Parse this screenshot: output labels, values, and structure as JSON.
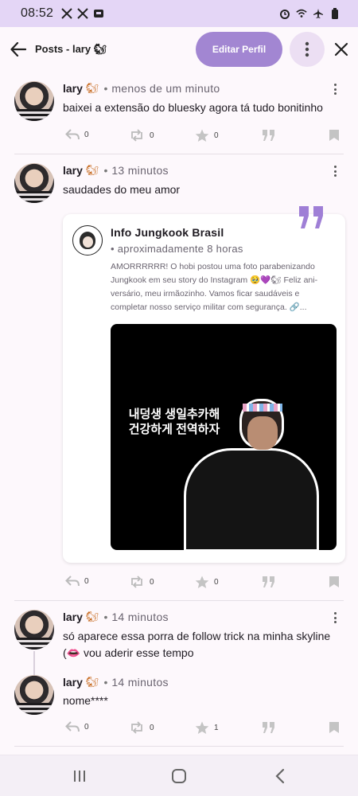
{
  "status_bar": {
    "time": "08:52",
    "left_icons": [
      "x-logo-icon",
      "x-logo-icon",
      "app-notification-icon"
    ],
    "right_icons": [
      "alarm-icon",
      "wifi-icon",
      "airplane-mode-icon",
      "battery-icon"
    ]
  },
  "header": {
    "title": "Posts - lary 🐿",
    "edit_profile_label": "Editar Perfil",
    "accent_color": "#a286d2"
  },
  "posts": [
    {
      "author": "lary",
      "author_emoji": "🐿",
      "time": "menos de um minuto",
      "text": "baixei a extensão do bluesky agora tá tudo bonitinho",
      "counts": {
        "reply": "0",
        "repost": "0",
        "like": "0"
      }
    },
    {
      "author": "lary",
      "author_emoji": "🐿",
      "time": "13 minutos",
      "text": "saudades do meu amor",
      "quote": {
        "author": "Info Jungkook Brasil",
        "time": "aproximadamente 8 horas",
        "text": "AMORRRRRR! O hobi postou uma foto parabenizando Jungkook em seu story do Instagram 🥹💜🐿 Feliz ani­versário, meu irmãozinho. Vamos ficar saudáveis e completar nosso serviço militar com segurança. 🔗...",
        "media_text": "내덩생 생일추카해 건강하게 전역하자"
      },
      "counts": {
        "reply": "0",
        "repost": "0",
        "like": "0"
      }
    },
    {
      "author": "lary",
      "author_emoji": "🐿",
      "time": "14 minutos",
      "text": "só aparece essa porra de follow trick na minha skyline (👄 vou aderir esse tempo"
    },
    {
      "author": "lary",
      "author_emoji": "🐿",
      "time": "14 minutos",
      "text": "nome****",
      "counts": {
        "reply": "0",
        "repost": "0",
        "like": "1"
      }
    }
  ]
}
